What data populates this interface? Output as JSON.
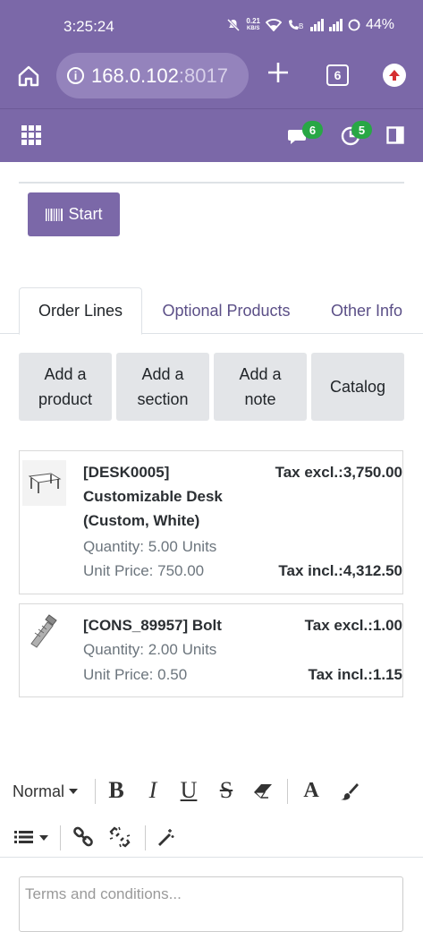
{
  "status_bar": {
    "time": "3:25:24",
    "net_speed_value": "0.21",
    "net_speed_unit": "KB/S",
    "battery": "44%"
  },
  "browser": {
    "url_host": "168.0.102",
    "url_port": ":8017",
    "tab_count": "6",
    "icons": [
      "home-icon",
      "info-icon",
      "plus-icon",
      "tabs-icon",
      "update-icon"
    ]
  },
  "app_nav": {
    "messages_count": "6",
    "activities_count": "5",
    "icons": [
      "apps-icon",
      "messages-icon",
      "activities-icon",
      "sidebar-icon"
    ]
  },
  "start_button": {
    "label": "Start"
  },
  "tabs": [
    {
      "label": "Order Lines",
      "active": true
    },
    {
      "label": "Optional Products",
      "active": false
    },
    {
      "label": "Other Info",
      "active": false
    }
  ],
  "actions": [
    {
      "line1": "Add a",
      "line2": "product"
    },
    {
      "line1": "Add a",
      "line2": "section"
    },
    {
      "line1": "Add a",
      "line2": "note"
    },
    {
      "line1": "Catalog",
      "line2": ""
    }
  ],
  "order_lines": [
    {
      "name_line1": "[DESK0005]",
      "name_line2": "Customizable Desk",
      "name_line3": "(Custom, White)",
      "quantity": "Quantity: 5.00 Units",
      "unit_price": "Unit Price: 750.00",
      "tax_excl": "Tax excl.:3,750.00",
      "tax_incl": "Tax incl.:4,312.50"
    },
    {
      "name_line1": "[CONS_89957] Bolt",
      "quantity": "Quantity: 2.00 Units",
      "unit_price": "Unit Price: 0.50",
      "tax_excl": "Tax excl.:1.00",
      "tax_incl": "Tax incl.:1.15"
    }
  ],
  "editor": {
    "style_select": "Normal",
    "tools": [
      "bold-icon",
      "italic-icon",
      "underline-icon",
      "strikethrough-icon",
      "eraser-icon",
      "font-color-icon",
      "background-color-icon",
      "list-icon",
      "link-icon",
      "unlink-icon",
      "magic-wand-icon"
    ],
    "bold": "B",
    "italic": "I",
    "underline": "U",
    "strike": "S",
    "font_color": "A",
    "terms_placeholder": "Terms and conditions..."
  }
}
